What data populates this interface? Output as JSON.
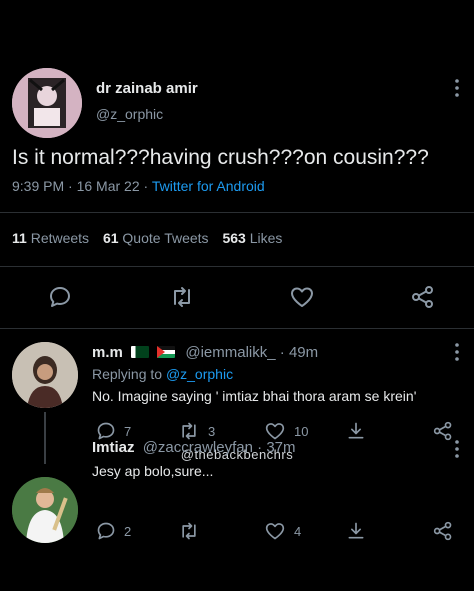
{
  "main_tweet": {
    "display_name": "dr zainab amir",
    "handle": "@z_orphic",
    "text": "Is it normal???having crush???on cousin???",
    "time": "9:39 PM",
    "date": "16 Mar 22",
    "source": "Twitter for Android",
    "stats": {
      "retweets_count": "11",
      "retweets_label": "Retweets",
      "quotes_count": "61",
      "quotes_label": "Quote Tweets",
      "likes_count": "563",
      "likes_label": "Likes"
    },
    "icons": [
      "reply-icon",
      "retweet-icon",
      "like-icon",
      "share-icon"
    ]
  },
  "reply1": {
    "display_name": "m.m",
    "flags": [
      "pakistan-flag",
      "palestine-flag"
    ],
    "handle": "@iemmalikk_",
    "time": "49m",
    "replying_prefix": "Replying to",
    "replying_handle": "@z_orphic",
    "text": "No. Imagine saying ' imtiaz bhai thora aram se krein'",
    "replies": "7",
    "retweets": "3",
    "likes": "10"
  },
  "watermark": "@thebackbenchrs",
  "reply2": {
    "display_name": "Imtiaz",
    "handle": "@zaccrawleyfan",
    "time": "37m",
    "text": "Jesy ap bolo,sure...",
    "replies": "2",
    "likes": "4"
  },
  "colors": {
    "background": "#000000",
    "text": "#e7e9ea",
    "muted": "#8b98a5",
    "accent": "#1d9bf0"
  }
}
